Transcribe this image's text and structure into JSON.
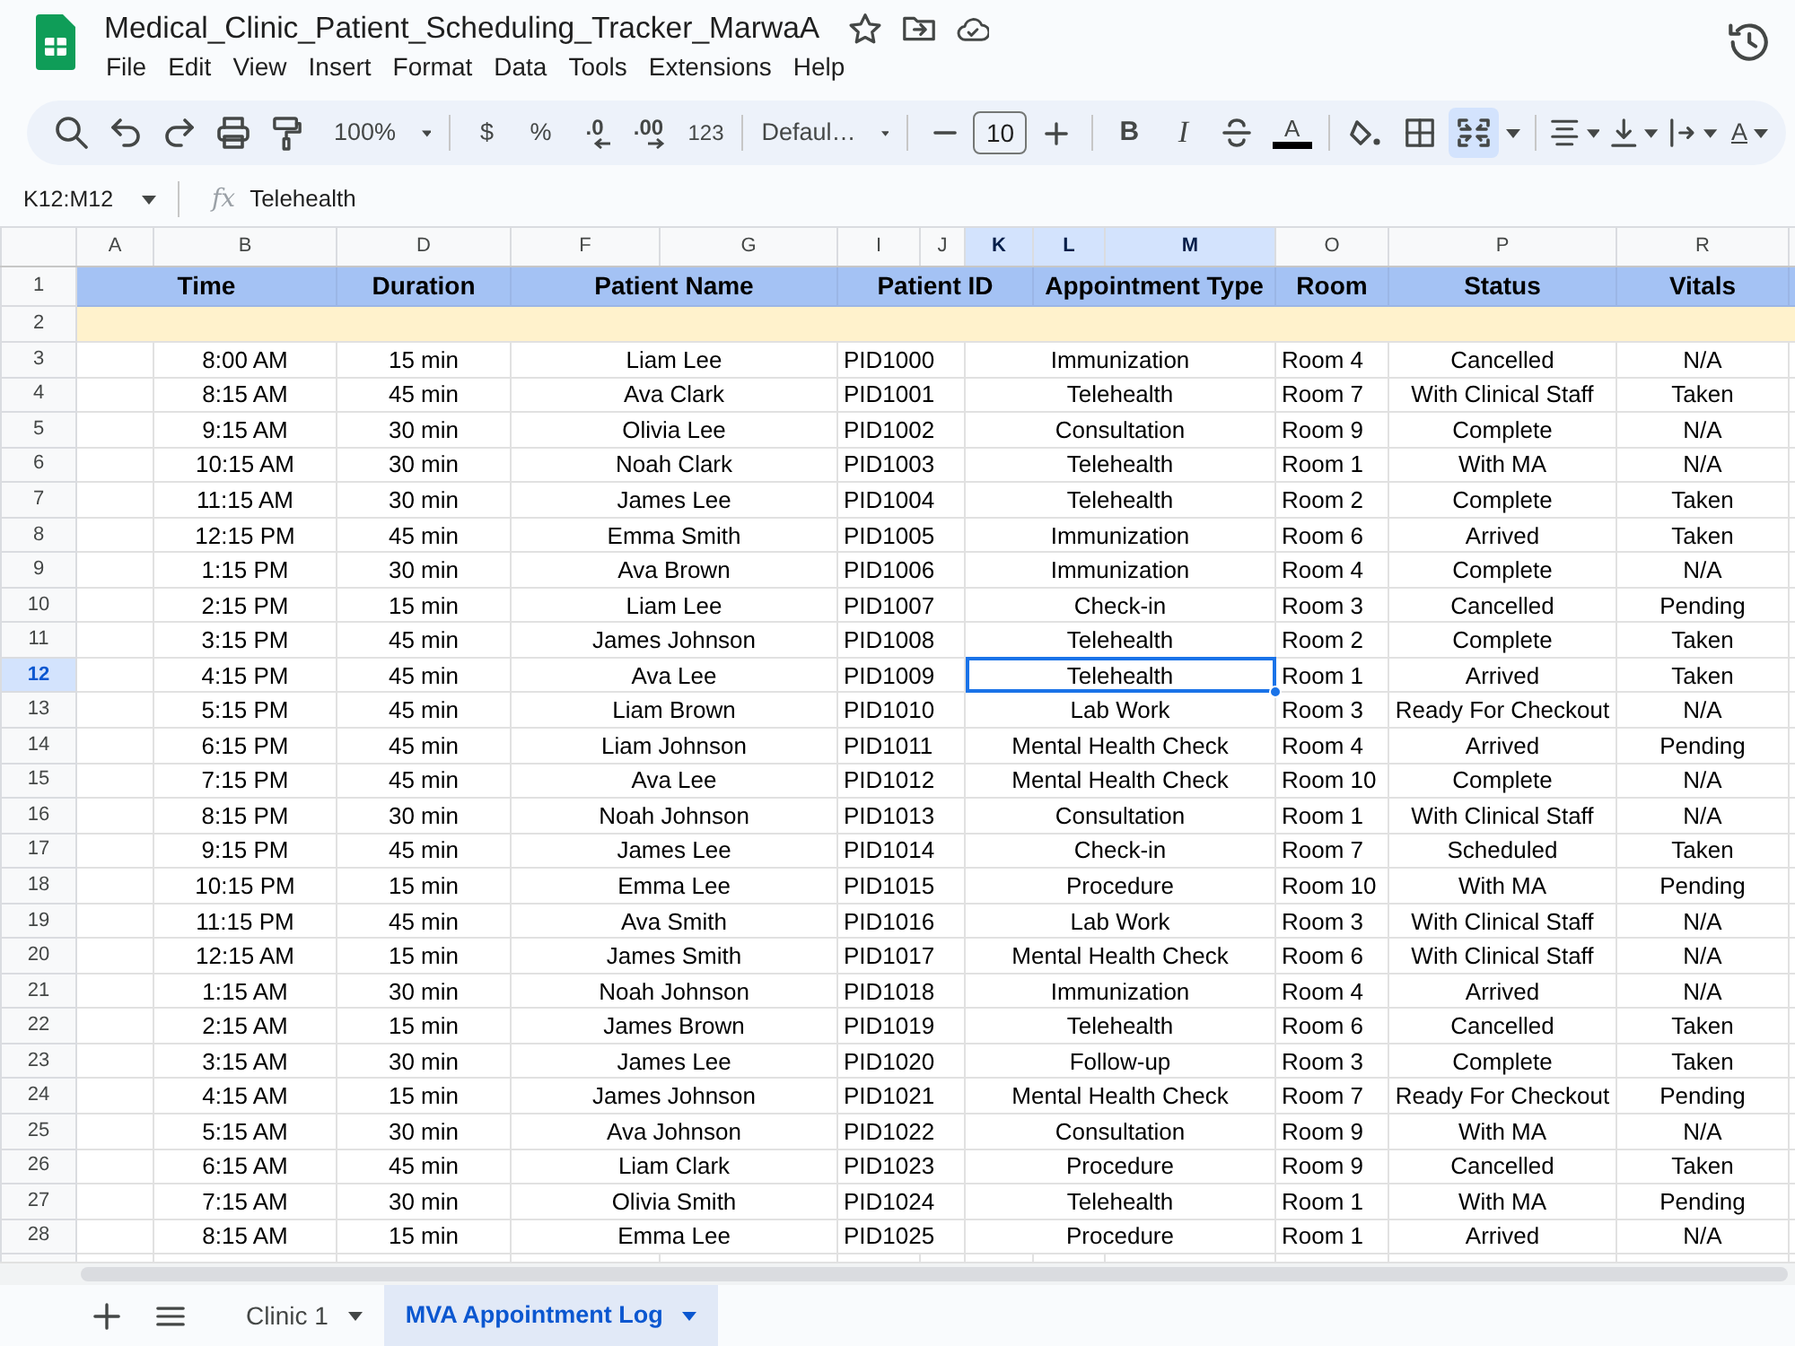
{
  "document": {
    "title": "Medical_Clinic_Patient_Scheduling_Tracker_MarwaA"
  },
  "menu": [
    "File",
    "Edit",
    "View",
    "Insert",
    "Format",
    "Data",
    "Tools",
    "Extensions",
    "Help"
  ],
  "toolbar": {
    "zoom": "100%",
    "currency": "$",
    "percent": "%",
    "decrease_decimal": ".0",
    "increase_decimal": ".00",
    "number_format": "123",
    "font": "Defaul…",
    "font_size": "10",
    "bold": "B",
    "italic": "I",
    "text_color": "A",
    "text_rotation": "A",
    "merge_on": true
  },
  "formula_bar": {
    "name_box": "K12:M12",
    "fx": "fx",
    "value": "Telehealth"
  },
  "sheet": {
    "columns": [
      {
        "letter": "A",
        "selected": false
      },
      {
        "letter": "B",
        "selected": false
      },
      {
        "letter": "D",
        "selected": false
      },
      {
        "letter": "F",
        "selected": false
      },
      {
        "letter": "G",
        "selected": false
      },
      {
        "letter": "I",
        "selected": false
      },
      {
        "letter": "J",
        "selected": false
      },
      {
        "letter": "K",
        "selected": true
      },
      {
        "letter": "L",
        "selected": true
      },
      {
        "letter": "M",
        "selected": true
      },
      {
        "letter": "O",
        "selected": false
      },
      {
        "letter": "P",
        "selected": false
      },
      {
        "letter": "R",
        "selected": false
      }
    ],
    "header_row": {
      "number": "1",
      "cells": [
        {
          "text": "Time",
          "colspan": 2
        },
        "Duration",
        {
          "text": "Patient Name",
          "colspan": 2
        },
        {
          "text": "Patient ID",
          "colspan": 3
        },
        {
          "text": "Appointment Type",
          "colspan": 2
        },
        "Room",
        "Status",
        "Vitals"
      ]
    },
    "band_row": {
      "number": "2"
    },
    "rows": [
      {
        "number": "3",
        "selected": false,
        "cells": [
          "",
          "8:00 AM",
          "15 min",
          {
            "text": "Liam Lee",
            "colspan": 2
          },
          {
            "text": "PID1000",
            "colspan": 2
          },
          {
            "text": "Immunization",
            "colspan": 3
          },
          "Room 4",
          "Cancelled",
          "N/A"
        ]
      },
      {
        "number": "4",
        "selected": false,
        "cells": [
          "",
          "8:15 AM",
          "45 min",
          {
            "text": "Ava Clark",
            "colspan": 2
          },
          {
            "text": "PID1001",
            "colspan": 2
          },
          {
            "text": "Telehealth",
            "colspan": 3
          },
          "Room 7",
          "With Clinical Staff",
          "Taken"
        ]
      },
      {
        "number": "5",
        "selected": false,
        "cells": [
          "",
          "9:15 AM",
          "30 min",
          {
            "text": "Olivia Lee",
            "colspan": 2
          },
          {
            "text": "PID1002",
            "colspan": 2
          },
          {
            "text": "Consultation",
            "colspan": 3
          },
          "Room 9",
          "Complete",
          "N/A"
        ]
      },
      {
        "number": "6",
        "selected": false,
        "cells": [
          "",
          "10:15 AM",
          "30 min",
          {
            "text": "Noah Clark",
            "colspan": 2
          },
          {
            "text": "PID1003",
            "colspan": 2
          },
          {
            "text": "Telehealth",
            "colspan": 3
          },
          "Room 1",
          "With MA",
          "N/A"
        ]
      },
      {
        "number": "7",
        "selected": false,
        "cells": [
          "",
          "11:15 AM",
          "30 min",
          {
            "text": "James Lee",
            "colspan": 2
          },
          {
            "text": "PID1004",
            "colspan": 2
          },
          {
            "text": "Telehealth",
            "colspan": 3
          },
          "Room 2",
          "Complete",
          "Taken"
        ]
      },
      {
        "number": "8",
        "selected": false,
        "cells": [
          "",
          "12:15 PM",
          "45 min",
          {
            "text": "Emma Smith",
            "colspan": 2
          },
          {
            "text": "PID1005",
            "colspan": 2
          },
          {
            "text": "Immunization",
            "colspan": 3
          },
          "Room 6",
          "Arrived",
          "Taken"
        ]
      },
      {
        "number": "9",
        "selected": false,
        "cells": [
          "",
          "1:15 PM",
          "30 min",
          {
            "text": "Ava Brown",
            "colspan": 2
          },
          {
            "text": "PID1006",
            "colspan": 2
          },
          {
            "text": "Immunization",
            "colspan": 3
          },
          "Room 4",
          "Complete",
          "N/A"
        ]
      },
      {
        "number": "10",
        "selected": false,
        "cells": [
          "",
          "2:15 PM",
          "15 min",
          {
            "text": "Liam Lee",
            "colspan": 2
          },
          {
            "text": "PID1007",
            "colspan": 2
          },
          {
            "text": "Check-in",
            "colspan": 3
          },
          "Room 3",
          "Cancelled",
          "Pending"
        ]
      },
      {
        "number": "11",
        "selected": false,
        "cells": [
          "",
          "3:15 PM",
          "45 min",
          {
            "text": "James Johnson",
            "colspan": 2
          },
          {
            "text": "PID1008",
            "colspan": 2
          },
          {
            "text": "Telehealth",
            "colspan": 3
          },
          "Room 2",
          "Complete",
          "Taken"
        ]
      },
      {
        "number": "12",
        "selected": true,
        "cells": [
          "",
          "4:15 PM",
          "45 min",
          {
            "text": "Ava Lee",
            "colspan": 2
          },
          {
            "text": "PID1009",
            "colspan": 2
          },
          {
            "text": "Telehealth",
            "colspan": 3
          },
          "Room 1",
          "Arrived",
          "Taken"
        ]
      },
      {
        "number": "13",
        "selected": false,
        "cells": [
          "",
          "5:15 PM",
          "45 min",
          {
            "text": "Liam Brown",
            "colspan": 2
          },
          {
            "text": "PID1010",
            "colspan": 2
          },
          {
            "text": "Lab Work",
            "colspan": 3
          },
          "Room 3",
          "Ready For Checkout",
          "N/A"
        ]
      },
      {
        "number": "14",
        "selected": false,
        "cells": [
          "",
          "6:15 PM",
          "45 min",
          {
            "text": "Liam Johnson",
            "colspan": 2
          },
          {
            "text": "PID1011",
            "colspan": 2
          },
          {
            "text": "Mental Health Check",
            "colspan": 3
          },
          "Room 4",
          "Arrived",
          "Pending"
        ]
      },
      {
        "number": "15",
        "selected": false,
        "cells": [
          "",
          "7:15 PM",
          "45 min",
          {
            "text": "Ava Lee",
            "colspan": 2
          },
          {
            "text": "PID1012",
            "colspan": 2
          },
          {
            "text": "Mental Health Check",
            "colspan": 3
          },
          "Room 10",
          "Complete",
          "N/A"
        ]
      },
      {
        "number": "16",
        "selected": false,
        "cells": [
          "",
          "8:15 PM",
          "30 min",
          {
            "text": "Noah Johnson",
            "colspan": 2
          },
          {
            "text": "PID1013",
            "colspan": 2
          },
          {
            "text": "Consultation",
            "colspan": 3
          },
          "Room 1",
          "With Clinical Staff",
          "N/A"
        ]
      },
      {
        "number": "17",
        "selected": false,
        "cells": [
          "",
          "9:15 PM",
          "45 min",
          {
            "text": "James Lee",
            "colspan": 2
          },
          {
            "text": "PID1014",
            "colspan": 2
          },
          {
            "text": "Check-in",
            "colspan": 3
          },
          "Room 7",
          "Scheduled",
          "Taken"
        ]
      },
      {
        "number": "18",
        "selected": false,
        "cells": [
          "",
          "10:15 PM",
          "15 min",
          {
            "text": "Emma Lee",
            "colspan": 2
          },
          {
            "text": "PID1015",
            "colspan": 2
          },
          {
            "text": "Procedure",
            "colspan": 3
          },
          "Room 10",
          "With MA",
          "Pending"
        ]
      },
      {
        "number": "19",
        "selected": false,
        "cells": [
          "",
          "11:15 PM",
          "45 min",
          {
            "text": "Ava Smith",
            "colspan": 2
          },
          {
            "text": "PID1016",
            "colspan": 2
          },
          {
            "text": "Lab Work",
            "colspan": 3
          },
          "Room 3",
          "With Clinical Staff",
          "N/A"
        ]
      },
      {
        "number": "20",
        "selected": false,
        "cells": [
          "",
          "12:15 AM",
          "15 min",
          {
            "text": "James Smith",
            "colspan": 2
          },
          {
            "text": "PID1017",
            "colspan": 2
          },
          {
            "text": "Mental Health Check",
            "colspan": 3
          },
          "Room 6",
          "With Clinical Staff",
          "N/A"
        ]
      },
      {
        "number": "21",
        "selected": false,
        "cells": [
          "",
          "1:15 AM",
          "30 min",
          {
            "text": "Noah Johnson",
            "colspan": 2
          },
          {
            "text": "PID1018",
            "colspan": 2
          },
          {
            "text": "Immunization",
            "colspan": 3
          },
          "Room 4",
          "Arrived",
          "N/A"
        ]
      },
      {
        "number": "22",
        "selected": false,
        "cells": [
          "",
          "2:15 AM",
          "15 min",
          {
            "text": "James Brown",
            "colspan": 2
          },
          {
            "text": "PID1019",
            "colspan": 2
          },
          {
            "text": "Telehealth",
            "colspan": 3
          },
          "Room 6",
          "Cancelled",
          "Taken"
        ]
      },
      {
        "number": "23",
        "selected": false,
        "cells": [
          "",
          "3:15 AM",
          "30 min",
          {
            "text": "James Lee",
            "colspan": 2
          },
          {
            "text": "PID1020",
            "colspan": 2
          },
          {
            "text": "Follow-up",
            "colspan": 3
          },
          "Room 3",
          "Complete",
          "Taken"
        ]
      },
      {
        "number": "24",
        "selected": false,
        "cells": [
          "",
          "4:15 AM",
          "15 min",
          {
            "text": "James Johnson",
            "colspan": 2
          },
          {
            "text": "PID1021",
            "colspan": 2
          },
          {
            "text": "Mental Health Check",
            "colspan": 3
          },
          "Room 7",
          "Ready For Checkout",
          "Pending"
        ]
      },
      {
        "number": "25",
        "selected": false,
        "cells": [
          "",
          "5:15 AM",
          "30 min",
          {
            "text": "Ava Johnson",
            "colspan": 2
          },
          {
            "text": "PID1022",
            "colspan": 2
          },
          {
            "text": "Consultation",
            "colspan": 3
          },
          "Room 9",
          "With MA",
          "N/A"
        ]
      },
      {
        "number": "26",
        "selected": false,
        "cells": [
          "",
          "6:15 AM",
          "45 min",
          {
            "text": "Liam Clark",
            "colspan": 2
          },
          {
            "text": "PID1023",
            "colspan": 2
          },
          {
            "text": "Procedure",
            "colspan": 3
          },
          "Room 9",
          "Cancelled",
          "Taken"
        ]
      },
      {
        "number": "27",
        "selected": false,
        "cells": [
          "",
          "7:15 AM",
          "30 min",
          {
            "text": "Olivia Smith",
            "colspan": 2
          },
          {
            "text": "PID1024",
            "colspan": 2
          },
          {
            "text": "Telehealth",
            "colspan": 3
          },
          "Room 1",
          "With MA",
          "Pending"
        ]
      },
      {
        "number": "28",
        "selected": false,
        "cells": [
          "",
          "8:15 AM",
          "15 min",
          {
            "text": "Emma Lee",
            "colspan": 2
          },
          {
            "text": "PID1025",
            "colspan": 2
          },
          {
            "text": "Procedure",
            "colspan": 3
          },
          "Room 1",
          "Arrived",
          "N/A"
        ]
      }
    ]
  },
  "sheet_tabs": [
    {
      "label": "Clinic 1",
      "selected": false
    },
    {
      "label": "MVA Appointment Log",
      "selected": true
    }
  ]
}
